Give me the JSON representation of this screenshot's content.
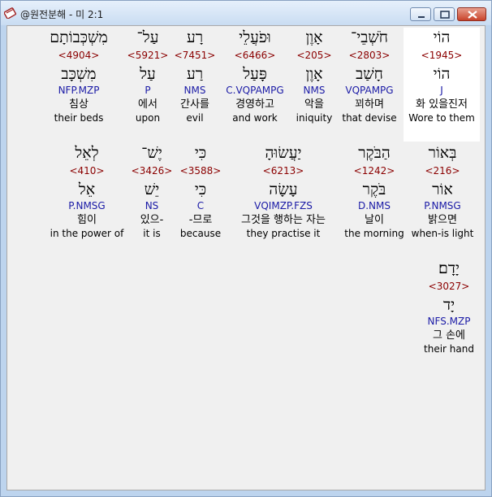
{
  "window": {
    "title": "@원전분해 - 미 2:1"
  },
  "rows": [
    [
      {
        "hebrew": "הוֹי",
        "strong": "<1945>",
        "lemma": "הוֹי",
        "morph": "J",
        "korean": "화 있을진저",
        "english": "Wore to them",
        "highlight": true
      },
      {
        "hebrew": "חֹשְׁבֵי־",
        "strong": "<2803>",
        "lemma": "חָשַׁב",
        "morph": "VQPAMPG",
        "korean": "꾀하며",
        "english": "that devise"
      },
      {
        "hebrew": "אָוֶן",
        "strong": "<205>",
        "lemma": "אָוֶן",
        "morph": "NMS",
        "korean": "악을",
        "english": "iniquity"
      },
      {
        "hebrew": "וּפֹעֲלֵי",
        "strong": "<6466>",
        "lemma": "פָּעַל",
        "morph": "C.VQPAMPG",
        "korean": "경영하고",
        "english": "and work"
      },
      {
        "hebrew": "רָע",
        "strong": "<7451>",
        "lemma": "רַע",
        "morph": "NMS",
        "korean": "간사를",
        "english": "evil"
      },
      {
        "hebrew": "עַל־",
        "strong": "<5921>",
        "lemma": "עַל",
        "morph": "P",
        "korean": "에서",
        "english": "upon"
      },
      {
        "hebrew": "מִשְׁכְּבוֹתָם",
        "strong": "<4904>",
        "lemma": "מִשְׁכָּב",
        "morph": "NFP.MZP",
        "korean": "침상",
        "english": "their beds"
      }
    ],
    [
      {
        "hebrew": "בְּאוֹר",
        "strong": "<216>",
        "lemma": "אוֹר",
        "morph": "P.NMSG",
        "korean": "밝으면",
        "english": "when-is light"
      },
      {
        "hebrew": "הַבֹּקֶר",
        "strong": "<1242>",
        "lemma": "בֹּקֶר",
        "morph": "D.NMS",
        "korean": "날이",
        "english": "the morning"
      },
      {
        "hebrew": "יַעֲשׂוּהָ",
        "strong": "<6213>",
        "lemma": "עָשָׂה",
        "morph": "VQIMZP.FZS",
        "korean": "그것을 행하는 자는",
        "english": "they practise it"
      },
      {
        "hebrew": "כִּי",
        "strong": "<3588>",
        "lemma": "כִּי",
        "morph": "C",
        "korean": "-므로",
        "english": "because"
      },
      {
        "hebrew": "יֶשׁ־",
        "strong": "<3426>",
        "lemma": "יֵשׁ",
        "morph": "NS",
        "korean": "있으-",
        "english": "it is"
      },
      {
        "hebrew": "לְאֵל",
        "strong": "<410>",
        "lemma": "אֵל",
        "morph": "P.NMSG",
        "korean": "힘이",
        "english": "in the power of"
      }
    ],
    [
      {
        "hebrew": "יָדָם׃",
        "strong": "<3027>",
        "lemma": "יָד",
        "morph": "NFS.MZP",
        "korean": "그 손에",
        "english": "their hand"
      }
    ]
  ]
}
